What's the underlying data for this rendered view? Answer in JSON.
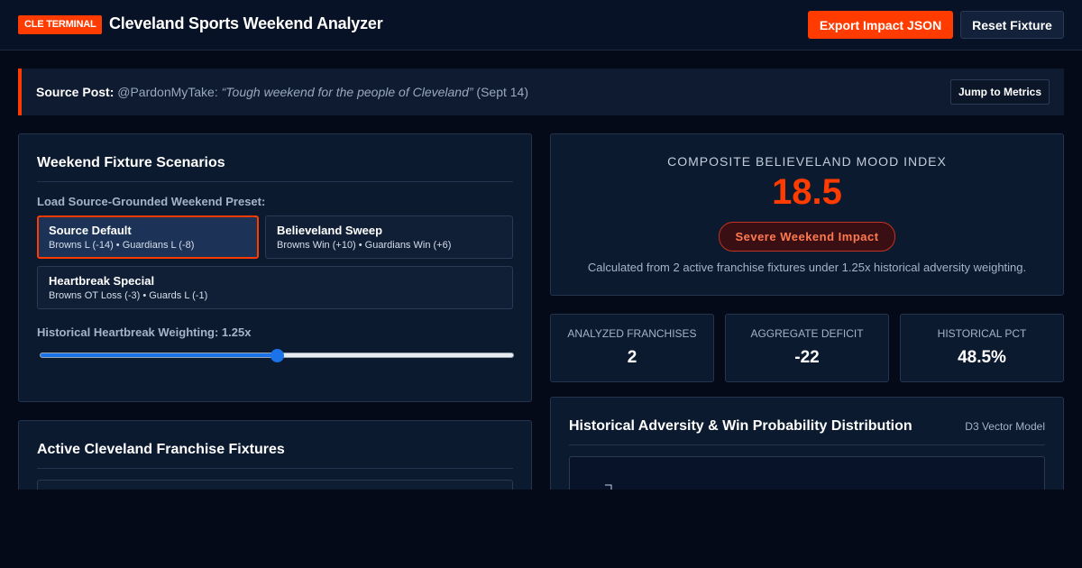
{
  "header": {
    "badge": "CLE TERMINAL",
    "title": "Cleveland Sports Weekend Analyzer",
    "export_label": "Export Impact JSON",
    "reset_label": "Reset Fixture"
  },
  "source": {
    "label": "Source Post:",
    "handle": "@PardonMyTake:",
    "quote": "“Tough weekend for the people of Cleveland”",
    "date": "(Sept 14)",
    "jump_label": "Jump to Metrics"
  },
  "scenarios": {
    "title": "Weekend Fixture Scenarios",
    "preset_label": "Load Source-Grounded Weekend Preset:",
    "presets": [
      {
        "title": "Source Default",
        "detail": "Browns L (-14) • Guardians L (-8)",
        "active": true
      },
      {
        "title": "Believeland Sweep",
        "detail": "Browns Win (+10) • Guardians Win (+6)",
        "active": false
      },
      {
        "title": "Heartbreak Special",
        "detail": "Browns OT Loss (-3) • Guards L (-1)",
        "active": false
      }
    ],
    "weighting_label": "Historical Heartbreak Weighting: 1.25x",
    "weighting_level": 0.5
  },
  "fixtures": {
    "title": "Active Cleveland Franchise Fixtures"
  },
  "mood": {
    "label": "COMPOSITE BELIEVELAND MOOD INDEX",
    "value": "18.5",
    "badge": "Severe Weekend Impact",
    "note": "Calculated from 2 active franchise fixtures under 1.25x historical adversity weighting."
  },
  "stats": [
    {
      "label": "ANALYZED FRANCHISES",
      "value": "2"
    },
    {
      "label": "AGGREGATE DEFICIT",
      "value": "-22"
    },
    {
      "label": "HISTORICAL PCT",
      "value": "48.5%"
    }
  ],
  "chart": {
    "title": "Historical Adversity & Win Probability Distribution",
    "tag": "D3 Vector Model"
  },
  "colors": {
    "accent": "#ff3b00",
    "background": "#040a17",
    "panel": "#0c1a30"
  }
}
